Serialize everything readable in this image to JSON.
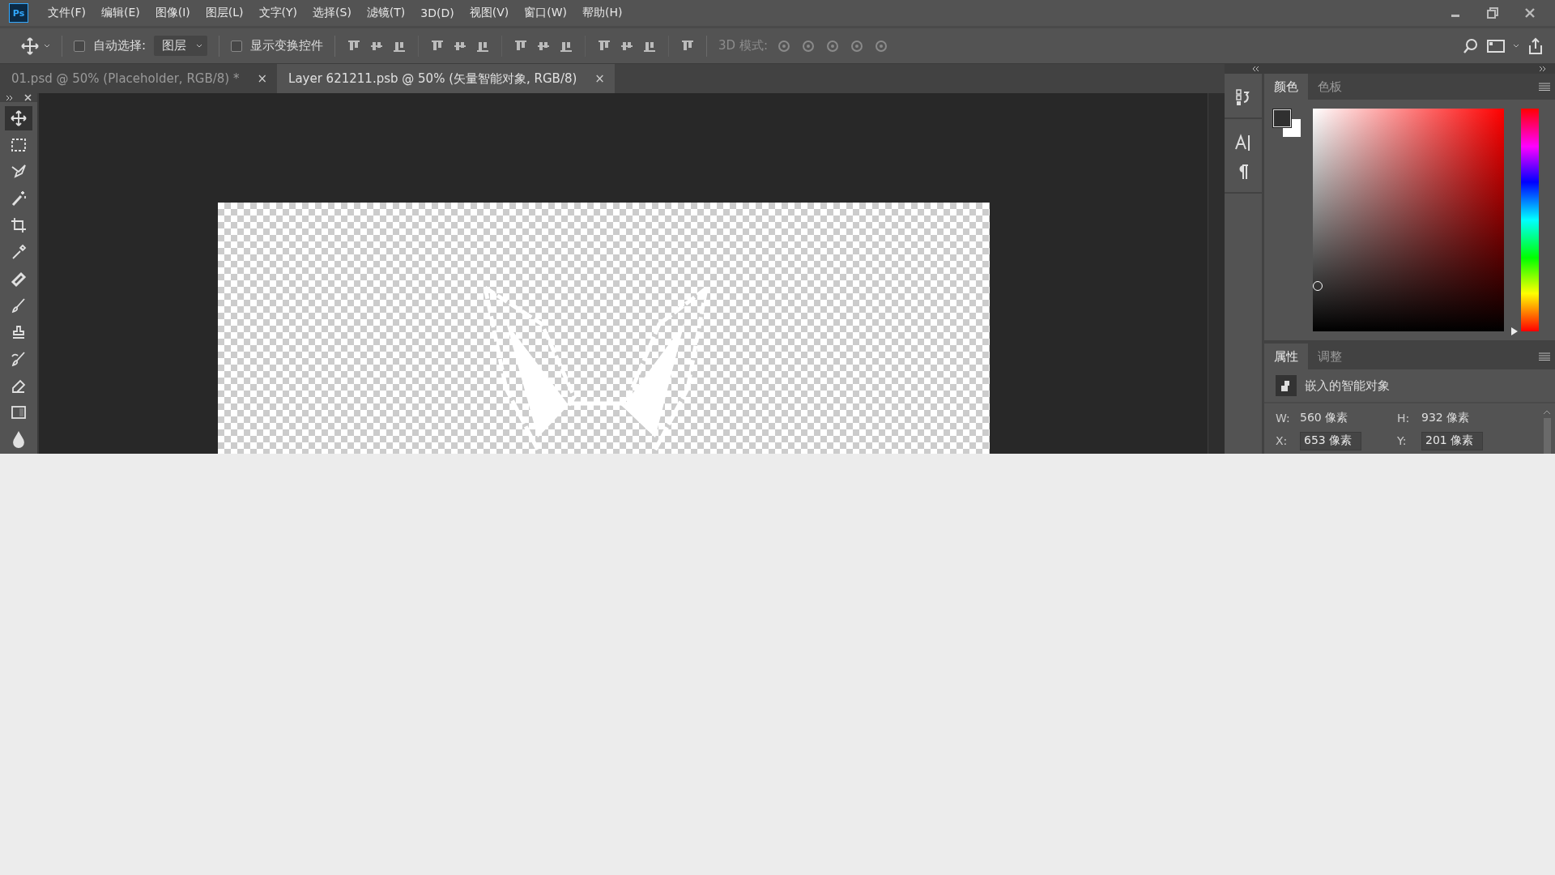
{
  "app": {
    "logo": "Ps"
  },
  "menu": [
    "文件(F)",
    "编辑(E)",
    "图像(I)",
    "图层(L)",
    "文字(Y)",
    "选择(S)",
    "滤镜(T)",
    "3D(D)",
    "视图(V)",
    "窗口(W)",
    "帮助(H)"
  ],
  "options_bar": {
    "auto_select": {
      "label": "自动选择:",
      "checked": false
    },
    "target": {
      "value": "图层"
    },
    "show_transform": {
      "label": "显示变换控件",
      "checked": false
    },
    "mode_3d_label": "3D 模式:"
  },
  "document_tabs": [
    {
      "title": "01.psd @ 50% (Placeholder, RGB/8) *",
      "close": "×",
      "selected": false
    },
    {
      "title": "Layer 621211.psb @ 50% (矢量智能对象, RGB/8)",
      "close": "×",
      "selected": true
    }
  ],
  "tools": [
    {
      "kind": "move",
      "selected": true
    },
    {
      "kind": "marquee",
      "selected": false
    },
    {
      "kind": "lasso",
      "selected": false
    },
    {
      "kind": "wand",
      "selected": false
    },
    {
      "kind": "crop",
      "selected": false
    },
    {
      "kind": "eyedropper",
      "selected": false
    },
    {
      "kind": "healing",
      "selected": false
    },
    {
      "kind": "brush",
      "selected": false
    },
    {
      "kind": "stamp",
      "selected": false
    },
    {
      "kind": "history",
      "selected": false
    },
    {
      "kind": "eraser",
      "selected": false
    },
    {
      "kind": "gradient",
      "selected": false
    },
    {
      "kind": "blur",
      "selected": false
    }
  ],
  "color_panel": {
    "tabs": [
      {
        "label": "颜色",
        "selected": true
      },
      {
        "label": "色板",
        "selected": false
      }
    ],
    "hue": {
      "level": 0
    }
  },
  "properties_panel": {
    "tabs": [
      {
        "label": "属性",
        "selected": true
      },
      {
        "label": "调整",
        "selected": false
      }
    ],
    "object_type": "嵌入的智能对象",
    "fields": [
      {
        "kind": "text",
        "label": "W:",
        "value": "560 像素"
      },
      {
        "kind": "text",
        "label": "H:",
        "value": "932 像素"
      },
      {
        "kind": "input",
        "label": "X:",
        "value": "653 像素"
      },
      {
        "kind": "input",
        "label": "Y:",
        "value": "201 像素"
      }
    ]
  }
}
